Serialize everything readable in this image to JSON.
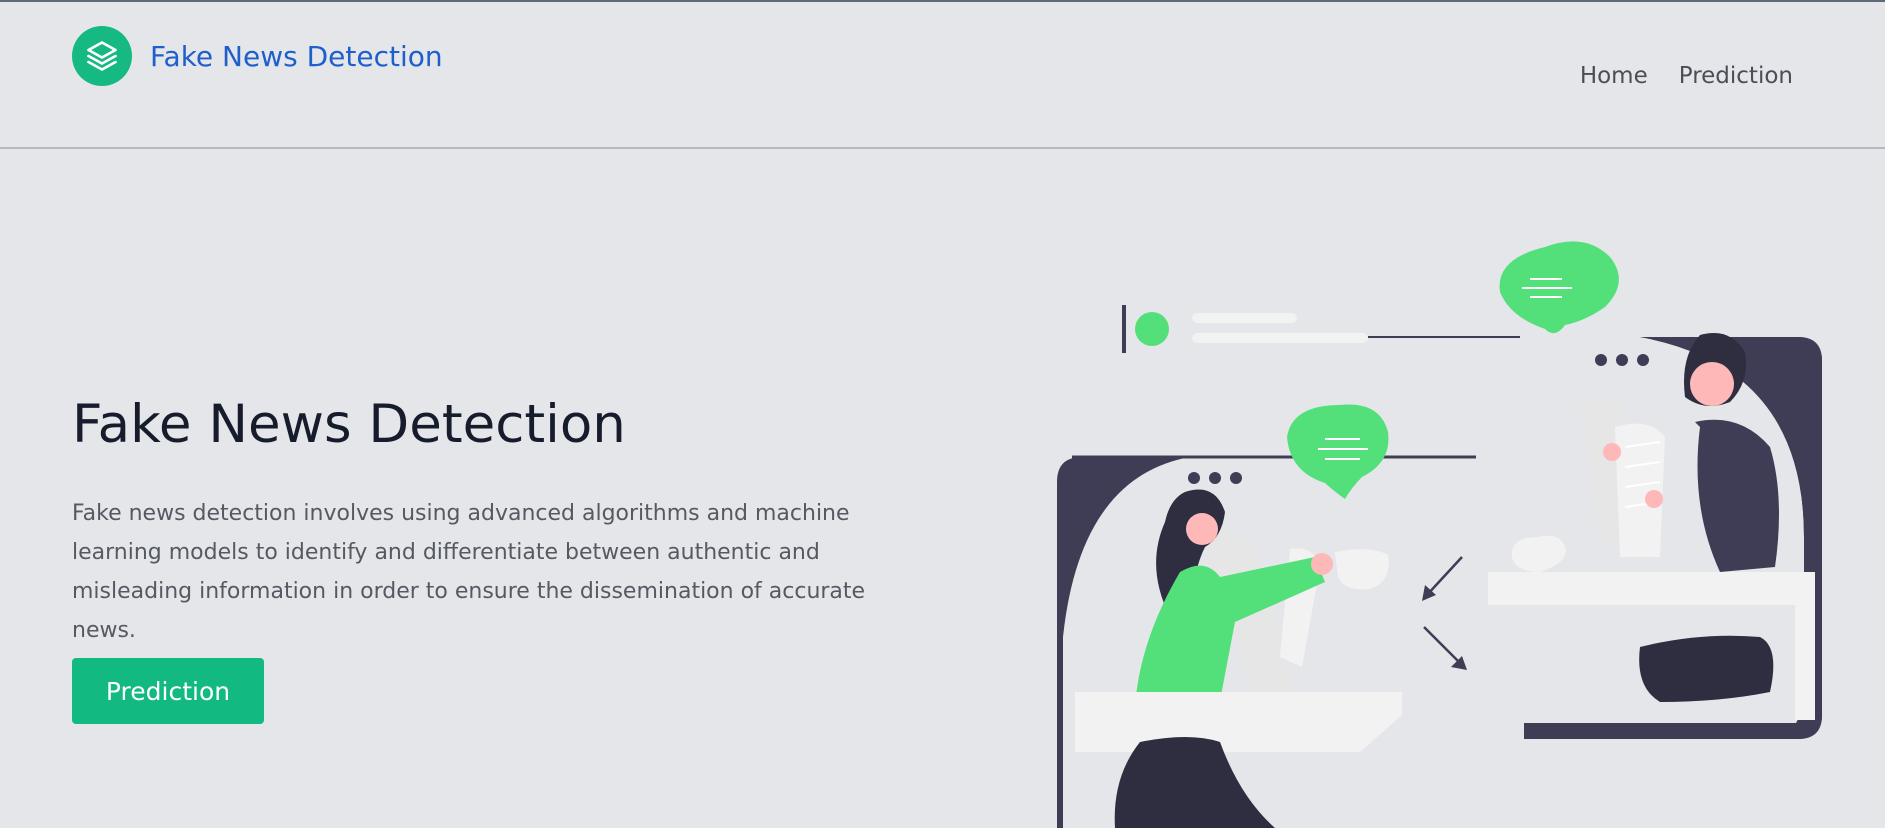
{
  "brand": {
    "name": "Fake News Detection",
    "logo_icon": "layers-icon",
    "accent": "#16b981"
  },
  "nav": {
    "items": [
      {
        "label": "Home"
      },
      {
        "label": "Prediction"
      }
    ]
  },
  "hero": {
    "title": "Fake News Detection",
    "description": "Fake news detection involves using advanced algorithms and machine learning models to identify and differentiate between authentic and misleading information in order to ensure the dissemination of accurate news.",
    "cta_label": "Prediction",
    "cta_color": "#12b981"
  },
  "colors": {
    "background": "#e5e6ea",
    "brand_text": "#1f5fcc",
    "illustration_green": "#53e07b",
    "illustration_dark": "#3f3d56"
  }
}
